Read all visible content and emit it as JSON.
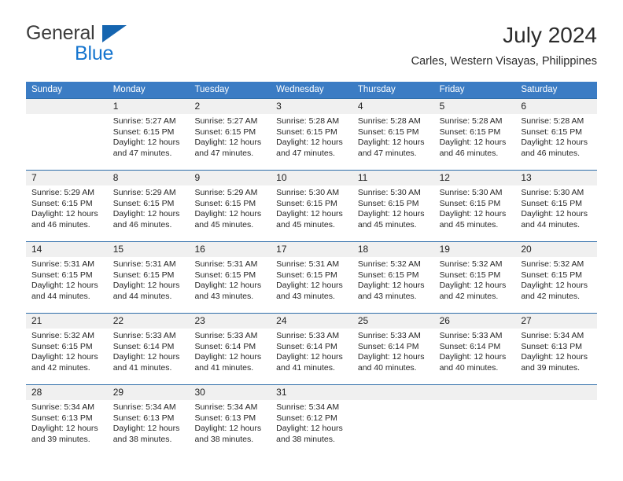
{
  "brand": {
    "name_dark": "General",
    "name_blue": "Blue",
    "triangle_icon": "triangle-logo-icon",
    "dark_color": "#3c3c3c",
    "blue_color": "#1575cf"
  },
  "header": {
    "title": "July 2024",
    "subtitle": "Carles, Western Visayas, Philippines"
  },
  "theme": {
    "header_blue": "#3b7cc4",
    "row_divider_blue": "#2e6da9",
    "daynum_band": "#f0f0f0",
    "text": "#262626"
  },
  "calendar": {
    "weekdays": [
      "Sunday",
      "Monday",
      "Tuesday",
      "Wednesday",
      "Thursday",
      "Friday",
      "Saturday"
    ],
    "weeks": [
      {
        "days": [
          {
            "num": "",
            "sunrise": "",
            "sunset": "",
            "daylight": "",
            "empty": true
          },
          {
            "num": "1",
            "sunrise": "Sunrise: 5:27 AM",
            "sunset": "Sunset: 6:15 PM",
            "daylight": "Daylight: 12 hours and 47 minutes.",
            "empty": false
          },
          {
            "num": "2",
            "sunrise": "Sunrise: 5:27 AM",
            "sunset": "Sunset: 6:15 PM",
            "daylight": "Daylight: 12 hours and 47 minutes.",
            "empty": false
          },
          {
            "num": "3",
            "sunrise": "Sunrise: 5:28 AM",
            "sunset": "Sunset: 6:15 PM",
            "daylight": "Daylight: 12 hours and 47 minutes.",
            "empty": false
          },
          {
            "num": "4",
            "sunrise": "Sunrise: 5:28 AM",
            "sunset": "Sunset: 6:15 PM",
            "daylight": "Daylight: 12 hours and 47 minutes.",
            "empty": false
          },
          {
            "num": "5",
            "sunrise": "Sunrise: 5:28 AM",
            "sunset": "Sunset: 6:15 PM",
            "daylight": "Daylight: 12 hours and 46 minutes.",
            "empty": false
          },
          {
            "num": "6",
            "sunrise": "Sunrise: 5:28 AM",
            "sunset": "Sunset: 6:15 PM",
            "daylight": "Daylight: 12 hours and 46 minutes.",
            "empty": false
          }
        ]
      },
      {
        "days": [
          {
            "num": "7",
            "sunrise": "Sunrise: 5:29 AM",
            "sunset": "Sunset: 6:15 PM",
            "daylight": "Daylight: 12 hours and 46 minutes.",
            "empty": false
          },
          {
            "num": "8",
            "sunrise": "Sunrise: 5:29 AM",
            "sunset": "Sunset: 6:15 PM",
            "daylight": "Daylight: 12 hours and 46 minutes.",
            "empty": false
          },
          {
            "num": "9",
            "sunrise": "Sunrise: 5:29 AM",
            "sunset": "Sunset: 6:15 PM",
            "daylight": "Daylight: 12 hours and 45 minutes.",
            "empty": false
          },
          {
            "num": "10",
            "sunrise": "Sunrise: 5:30 AM",
            "sunset": "Sunset: 6:15 PM",
            "daylight": "Daylight: 12 hours and 45 minutes.",
            "empty": false
          },
          {
            "num": "11",
            "sunrise": "Sunrise: 5:30 AM",
            "sunset": "Sunset: 6:15 PM",
            "daylight": "Daylight: 12 hours and 45 minutes.",
            "empty": false
          },
          {
            "num": "12",
            "sunrise": "Sunrise: 5:30 AM",
            "sunset": "Sunset: 6:15 PM",
            "daylight": "Daylight: 12 hours and 45 minutes.",
            "empty": false
          },
          {
            "num": "13",
            "sunrise": "Sunrise: 5:30 AM",
            "sunset": "Sunset: 6:15 PM",
            "daylight": "Daylight: 12 hours and 44 minutes.",
            "empty": false
          }
        ]
      },
      {
        "days": [
          {
            "num": "14",
            "sunrise": "Sunrise: 5:31 AM",
            "sunset": "Sunset: 6:15 PM",
            "daylight": "Daylight: 12 hours and 44 minutes.",
            "empty": false
          },
          {
            "num": "15",
            "sunrise": "Sunrise: 5:31 AM",
            "sunset": "Sunset: 6:15 PM",
            "daylight": "Daylight: 12 hours and 44 minutes.",
            "empty": false
          },
          {
            "num": "16",
            "sunrise": "Sunrise: 5:31 AM",
            "sunset": "Sunset: 6:15 PM",
            "daylight": "Daylight: 12 hours and 43 minutes.",
            "empty": false
          },
          {
            "num": "17",
            "sunrise": "Sunrise: 5:31 AM",
            "sunset": "Sunset: 6:15 PM",
            "daylight": "Daylight: 12 hours and 43 minutes.",
            "empty": false
          },
          {
            "num": "18",
            "sunrise": "Sunrise: 5:32 AM",
            "sunset": "Sunset: 6:15 PM",
            "daylight": "Daylight: 12 hours and 43 minutes.",
            "empty": false
          },
          {
            "num": "19",
            "sunrise": "Sunrise: 5:32 AM",
            "sunset": "Sunset: 6:15 PM",
            "daylight": "Daylight: 12 hours and 42 minutes.",
            "empty": false
          },
          {
            "num": "20",
            "sunrise": "Sunrise: 5:32 AM",
            "sunset": "Sunset: 6:15 PM",
            "daylight": "Daylight: 12 hours and 42 minutes.",
            "empty": false
          }
        ]
      },
      {
        "days": [
          {
            "num": "21",
            "sunrise": "Sunrise: 5:32 AM",
            "sunset": "Sunset: 6:15 PM",
            "daylight": "Daylight: 12 hours and 42 minutes.",
            "empty": false
          },
          {
            "num": "22",
            "sunrise": "Sunrise: 5:33 AM",
            "sunset": "Sunset: 6:14 PM",
            "daylight": "Daylight: 12 hours and 41 minutes.",
            "empty": false
          },
          {
            "num": "23",
            "sunrise": "Sunrise: 5:33 AM",
            "sunset": "Sunset: 6:14 PM",
            "daylight": "Daylight: 12 hours and 41 minutes.",
            "empty": false
          },
          {
            "num": "24",
            "sunrise": "Sunrise: 5:33 AM",
            "sunset": "Sunset: 6:14 PM",
            "daylight": "Daylight: 12 hours and 41 minutes.",
            "empty": false
          },
          {
            "num": "25",
            "sunrise": "Sunrise: 5:33 AM",
            "sunset": "Sunset: 6:14 PM",
            "daylight": "Daylight: 12 hours and 40 minutes.",
            "empty": false
          },
          {
            "num": "26",
            "sunrise": "Sunrise: 5:33 AM",
            "sunset": "Sunset: 6:14 PM",
            "daylight": "Daylight: 12 hours and 40 minutes.",
            "empty": false
          },
          {
            "num": "27",
            "sunrise": "Sunrise: 5:34 AM",
            "sunset": "Sunset: 6:13 PM",
            "daylight": "Daylight: 12 hours and 39 minutes.",
            "empty": false
          }
        ]
      },
      {
        "days": [
          {
            "num": "28",
            "sunrise": "Sunrise: 5:34 AM",
            "sunset": "Sunset: 6:13 PM",
            "daylight": "Daylight: 12 hours and 39 minutes.",
            "empty": false
          },
          {
            "num": "29",
            "sunrise": "Sunrise: 5:34 AM",
            "sunset": "Sunset: 6:13 PM",
            "daylight": "Daylight: 12 hours and 38 minutes.",
            "empty": false
          },
          {
            "num": "30",
            "sunrise": "Sunrise: 5:34 AM",
            "sunset": "Sunset: 6:13 PM",
            "daylight": "Daylight: 12 hours and 38 minutes.",
            "empty": false
          },
          {
            "num": "31",
            "sunrise": "Sunrise: 5:34 AM",
            "sunset": "Sunset: 6:12 PM",
            "daylight": "Daylight: 12 hours and 38 minutes.",
            "empty": false
          },
          {
            "num": "",
            "sunrise": "",
            "sunset": "",
            "daylight": "",
            "empty": true
          },
          {
            "num": "",
            "sunrise": "",
            "sunset": "",
            "daylight": "",
            "empty": true
          },
          {
            "num": "",
            "sunrise": "",
            "sunset": "",
            "daylight": "",
            "empty": true
          }
        ]
      }
    ]
  }
}
